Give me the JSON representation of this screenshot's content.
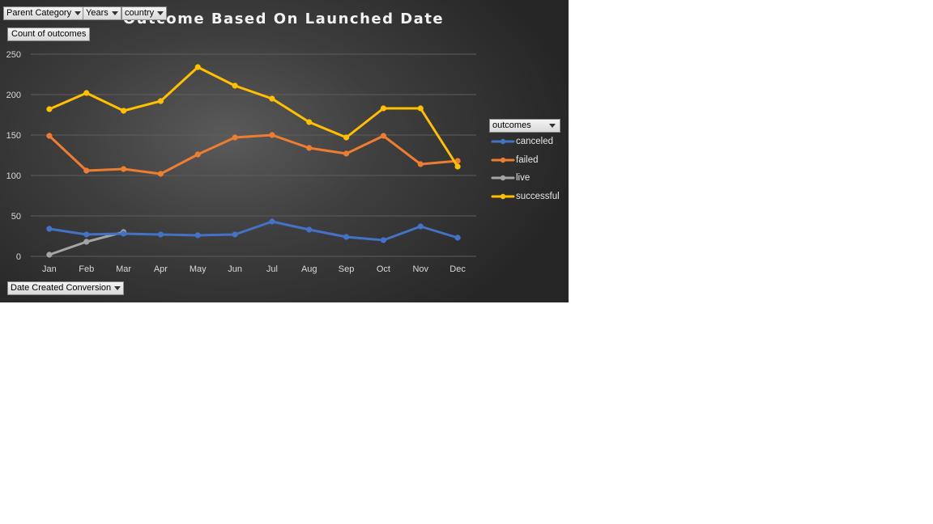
{
  "chart_title": "Outcome Based On Launched Date",
  "filters": {
    "parent_category": "Parent Category",
    "years": "Years",
    "country": "country"
  },
  "value_field": "Count of outcomes",
  "axis_field": "Date Created Conversion",
  "legend_field": "outcomes",
  "colors": {
    "canceled": "#4472c4",
    "failed": "#ed7d31",
    "live": "#a5a5a5",
    "successful": "#ffc000",
    "gridline": "#5e5e5e",
    "tick_text": "#d9d9d9"
  },
  "chart_data": {
    "type": "line",
    "title": "Outcome Based On Launched Date",
    "xlabel": "",
    "ylabel": "",
    "categories": [
      "Jan",
      "Feb",
      "Mar",
      "Apr",
      "May",
      "Jun",
      "Jul",
      "Aug",
      "Sep",
      "Oct",
      "Nov",
      "Dec"
    ],
    "ylim": [
      0,
      250
    ],
    "yticks": [
      0,
      50,
      100,
      150,
      200,
      250
    ],
    "grid": true,
    "legend_position": "right",
    "series": [
      {
        "name": "canceled",
        "color": "#4472c4",
        "values": [
          34,
          27,
          28,
          27,
          26,
          27,
          43,
          33,
          24,
          20,
          37,
          23
        ]
      },
      {
        "name": "failed",
        "color": "#ed7d31",
        "values": [
          149,
          106,
          108,
          102,
          126,
          147,
          150,
          134,
          127,
          149,
          114,
          118
        ]
      },
      {
        "name": "live",
        "color": "#a5a5a5",
        "values": [
          2,
          18,
          30,
          null,
          null,
          null,
          null,
          null,
          null,
          null,
          null,
          null
        ]
      },
      {
        "name": "successful",
        "color": "#ffc000",
        "values": [
          182,
          202,
          180,
          192,
          234,
          211,
          195,
          166,
          147,
          183,
          183,
          111
        ]
      }
    ]
  }
}
